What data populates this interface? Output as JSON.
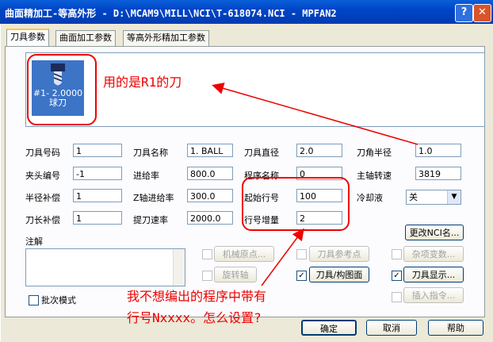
{
  "window": {
    "title": "曲面精加工-等高外形 - D:\\MCAM9\\MILL\\NCI\\T-618074.NCI - MPFAN2",
    "help_glyph": "?",
    "close_glyph": "✕"
  },
  "tabs": [
    "刀具参数",
    "曲面加工参数",
    "等高外形精加工参数"
  ],
  "tool_tile": {
    "number": "#1- 2.0000",
    "name": "球刀"
  },
  "annotations": {
    "tool_note": "用的是R1的刀",
    "question_line1": "我不想编出的程序中带有",
    "question_line2": "行号Nxxxx。怎么设置?"
  },
  "fields": {
    "tool_number": {
      "label": "刀具号码",
      "value": "1"
    },
    "tool_name": {
      "label": "刀具名称",
      "value": "1. BALL"
    },
    "tool_dia": {
      "label": "刀具直径",
      "value": "2.0"
    },
    "corner_radius": {
      "label": "刀角半径",
      "value": "1.0"
    },
    "holder_num": {
      "label": "夹头编号",
      "value": "-1"
    },
    "feed_rate": {
      "label": "进给率",
      "value": "800.0"
    },
    "program_name": {
      "label": "程序名称",
      "value": "0"
    },
    "spindle_speed": {
      "label": "主轴转速",
      "value": "3819"
    },
    "dia_offset": {
      "label": "半径补偿",
      "value": "1"
    },
    "plunge_rate": {
      "label": "Z轴进给率",
      "value": "300.0"
    },
    "start_seq": {
      "label": "起始行号",
      "value": "100"
    },
    "coolant": {
      "label": "冷却液",
      "value": "关"
    },
    "len_offset": {
      "label": "刀长补偿",
      "value": "1"
    },
    "retract_rate": {
      "label": "提刀速率",
      "value": "2000.0"
    },
    "seq_increment": {
      "label": "行号增量",
      "value": "2"
    }
  },
  "comment_label": "注解",
  "buttons": {
    "change_nci": "更改NCI名...",
    "machine_origin": "机械原点...",
    "tool_ref_point": "刀具参考点",
    "misc_values": "杂项变数...",
    "rotary_axis": "旋转轴",
    "tool_plane": "刀具/构图面",
    "tool_display": "刀具显示...",
    "insert_cmd": "插入指令...",
    "ok": "确定",
    "cancel": "取消",
    "help": "帮助"
  },
  "checkboxes": {
    "batch_mode": {
      "label": "批次模式",
      "checked": false
    },
    "tool_plane_checked": "✓",
    "tool_display_checked": "✓"
  }
}
